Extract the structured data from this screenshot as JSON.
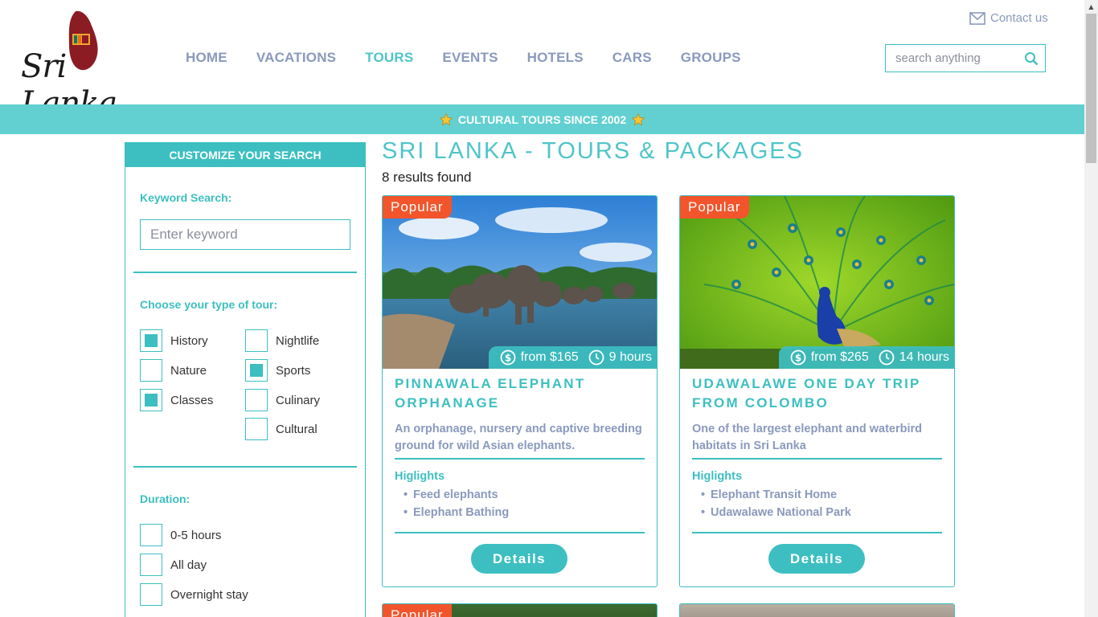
{
  "header": {
    "logo_text": "Sri Lanka",
    "contact_label": "Contact us",
    "search_placeholder": "search anything",
    "nav": [
      {
        "label": "HOME",
        "active": false
      },
      {
        "label": "VACATIONS",
        "active": false
      },
      {
        "label": "TOURS",
        "active": true
      },
      {
        "label": "EVENTS",
        "active": false
      },
      {
        "label": "HOTELS",
        "active": false
      },
      {
        "label": "CARS",
        "active": false
      },
      {
        "label": "GROUPS",
        "active": false
      }
    ]
  },
  "banner": {
    "text": "CULTURAL TOURS SINCE 2002",
    "icon": "star-icon"
  },
  "sidebar": {
    "title": "CUSTOMIZE YOUR SEARCH",
    "keyword_label": "Keyword Search:",
    "keyword_placeholder": "Enter keyword",
    "tour_type_label": "Choose your type of tour:",
    "tour_types": [
      {
        "label": "History",
        "checked": true
      },
      {
        "label": "Nightlife",
        "checked": false
      },
      {
        "label": "Nature",
        "checked": false
      },
      {
        "label": "Sports",
        "checked": true
      },
      {
        "label": "Classes",
        "checked": true
      },
      {
        "label": "Culinary",
        "checked": false
      },
      {
        "label": "Cultural",
        "checked": false
      }
    ],
    "duration_label": "Duration:",
    "durations": [
      {
        "label": "0-5 hours",
        "checked": false
      },
      {
        "label": "All day",
        "checked": false
      },
      {
        "label": "Overnight stay",
        "checked": false
      }
    ]
  },
  "main": {
    "title": "SRI LANKA - TOURS & PACKAGES",
    "results": "8 results found",
    "cards": [
      {
        "badge": "Popular",
        "price": "from $165",
        "duration": "9 hours",
        "title": "PINNAWALA ELEPHANT ORPHANAGE",
        "description": "An orphanage, nursery and captive breeding ground for wild Asian elephants.",
        "highlights_label": "Higlights",
        "highlights": [
          "Feed elephants",
          "Elephant Bathing"
        ],
        "button": "Details"
      },
      {
        "badge": "Popular",
        "price": "from $265",
        "duration": "14 hours",
        "title": "UDAWALAWE ONE DAY TRIP FROM COLOMBO",
        "description": "One of the largest elephant and waterbird habitats in Sri Lanka",
        "highlights_label": "Higlights",
        "highlights": [
          "Elephant Transit Home",
          "Udawalawe National Park"
        ],
        "button": "Details"
      },
      {
        "badge": "Popular"
      }
    ]
  },
  "colors": {
    "accent": "#3dbfc1",
    "banner": "#62d0d0",
    "nav": "#8a99bd",
    "badge": "#f2552c"
  }
}
